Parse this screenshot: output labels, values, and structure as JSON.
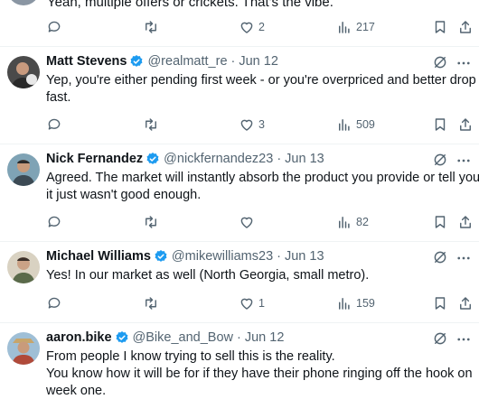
{
  "partial_tweet": {
    "text": "Yeah, multiple offers or crickets. That's the vibe.",
    "views": "217",
    "likes": "2"
  },
  "tweets": [
    {
      "name": "Matt Stevens",
      "handle": "@realmatt_re",
      "dot": "·",
      "time": "Jun 12",
      "lines": [
        "Yep, you're either pending first week - or you're overpriced and better drop",
        "fast."
      ],
      "replies": "",
      "retweets": "",
      "likes": "3",
      "views": "509"
    },
    {
      "name": "Nick Fernandez",
      "handle": "@nickfernandez23",
      "dot": "·",
      "time": "Jun 13",
      "lines": [
        "Agreed. The market will instantly absorb the product you provide or tell you",
        "it just wasn't good enough."
      ],
      "replies": "",
      "retweets": "",
      "likes": "",
      "views": "82"
    },
    {
      "name": "Michael Williams",
      "handle": "@mikewilliams23",
      "dot": "·",
      "time": "Jun 13",
      "lines": [
        "Yes! In our market as well (North Georgia, small metro)."
      ],
      "replies": "",
      "retweets": "",
      "likes": "1",
      "views": "159"
    },
    {
      "name": "aaron.bike",
      "handle": "@Bike_and_Bow",
      "dot": "·",
      "time": "Jun 12",
      "lines": [
        "From people I know trying to sell this is the reality.",
        "You know how it will be for if they have their phone ringing off the hook on",
        "week one."
      ]
    }
  ],
  "icons": {
    "reply": "reply-icon",
    "retweet": "retweet-icon",
    "like": "heart-icon",
    "views": "views-icon",
    "bookmark": "bookmark-icon",
    "share": "share-icon",
    "grok": "grok-icon",
    "more": "more-icon",
    "verified": "verified-badge-icon"
  },
  "colors": {
    "verified": "#1d9bf0",
    "text": "#0f1419",
    "muted": "#536471",
    "divider": "#eff3f4"
  }
}
